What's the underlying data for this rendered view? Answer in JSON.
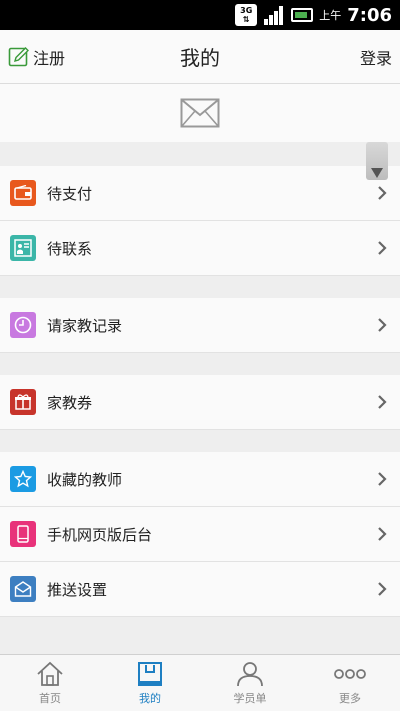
{
  "status_bar": {
    "network": "3G",
    "ampm": "上午",
    "time": "7:06"
  },
  "header": {
    "register_label": "注册",
    "title": "我的",
    "login_label": "登录"
  },
  "menu_groups": [
    [
      {
        "label": "待支付",
        "icon": "wallet-icon",
        "color": "#e8581d"
      },
      {
        "label": "待联系",
        "icon": "contact-board-icon",
        "color": "#3bb6a8"
      }
    ],
    [
      {
        "label": "请家教记录",
        "icon": "clock-icon",
        "color": "#c879e0"
      }
    ],
    [
      {
        "label": "家教券",
        "icon": "gift-icon",
        "color": "#c7342b"
      }
    ],
    [
      {
        "label": "收藏的教师",
        "icon": "star-icon",
        "color": "#1b9be3"
      },
      {
        "label": "手机网页版后台",
        "icon": "phone-icon",
        "color": "#e8327a"
      },
      {
        "label": "推送设置",
        "icon": "envelope-icon",
        "color": "#3d7fc1"
      }
    ]
  ],
  "bottom_nav": [
    {
      "label": "首页",
      "icon": "home-icon",
      "active": false
    },
    {
      "label": "我的",
      "icon": "my-icon",
      "active": true
    },
    {
      "label": "学员单",
      "icon": "person-icon",
      "active": false
    },
    {
      "label": "更多",
      "icon": "more-icon",
      "active": false
    }
  ],
  "colors": {
    "accent": "#1e7fc2",
    "edit_icon": "#3a9a3a"
  }
}
